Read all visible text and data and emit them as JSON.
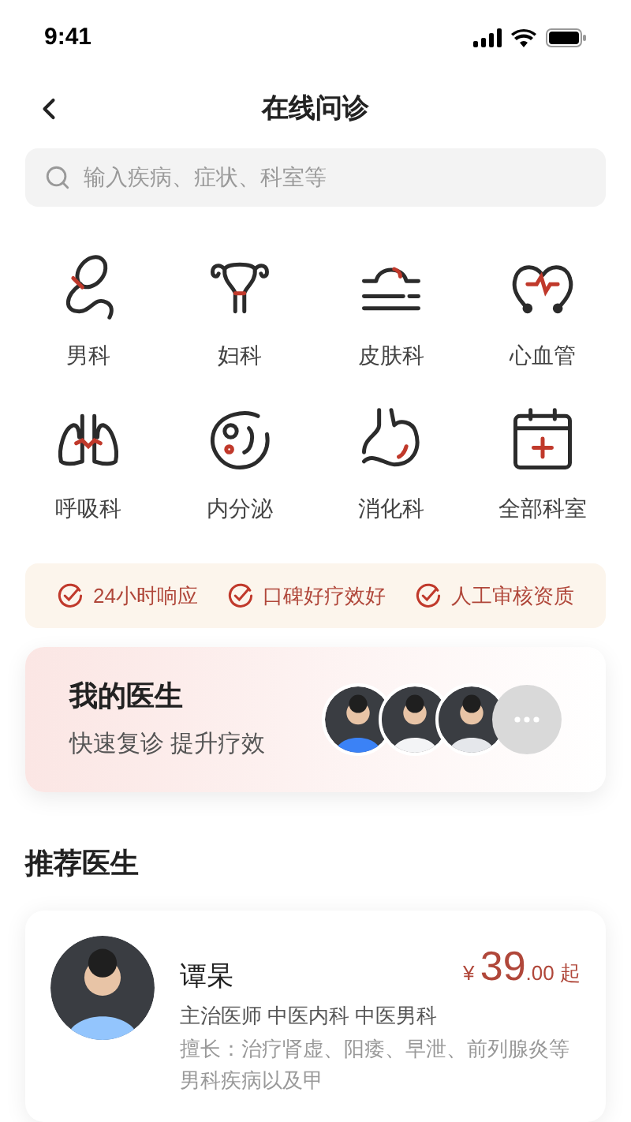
{
  "status_bar": {
    "time": "9:41"
  },
  "header": {
    "title": "在线问诊"
  },
  "search": {
    "placeholder": "输入疾病、症状、科室等"
  },
  "departments": [
    {
      "label": "男科",
      "kind": "sperm"
    },
    {
      "label": "妇科",
      "kind": "uterus"
    },
    {
      "label": "皮肤科",
      "kind": "skin"
    },
    {
      "label": "心血管",
      "kind": "heart"
    },
    {
      "label": "呼吸科",
      "kind": "lungs"
    },
    {
      "label": "内分泌",
      "kind": "cell"
    },
    {
      "label": "消化科",
      "kind": "stomach"
    },
    {
      "label": "全部科室",
      "kind": "calendar"
    }
  ],
  "guarantees": [
    "24小时响应",
    "口碑好疗效好",
    "人工审核资质"
  ],
  "my_doctors": {
    "title": "我的医生",
    "subtitle": "快速复诊 提升疗效",
    "avatars": [
      {
        "color": "#3b82f6"
      },
      {
        "color": "#f3f4f6"
      },
      {
        "color": "#e5e7eb"
      }
    ]
  },
  "recommended": {
    "title": "推荐医生",
    "doctors": [
      {
        "name": "谭杲",
        "price_symbol": "¥",
        "price": "39",
        "price_decimal": ".00",
        "price_suffix": "起",
        "titles": "主治医师 中医内科 中医男科",
        "specialty": "擅长：治疗肾虚、阳痿、早泄、前列腺炎等",
        "specialty_more": "男科疾病以及甲"
      }
    ]
  }
}
